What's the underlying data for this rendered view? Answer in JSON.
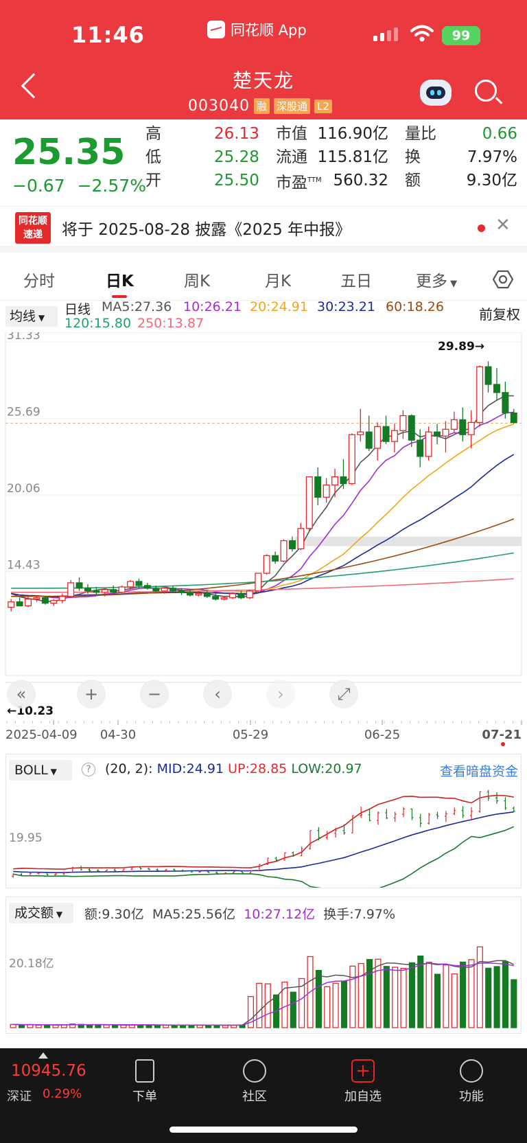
{
  "status": {
    "time": "11:46",
    "app": "同花顺 App",
    "battery": "99"
  },
  "stock": {
    "name": "楚天龙",
    "code": "003040",
    "tags": [
      "融",
      "深股通",
      "L2"
    ],
    "price": "25.35",
    "change": "−0.67",
    "change_pct": "−2.57%"
  },
  "quote": [
    {
      "label": "高",
      "value": "26.13",
      "color": "red"
    },
    {
      "label": "低",
      "value": "25.28",
      "color": "grn"
    },
    {
      "label": "开",
      "value": "25.50",
      "color": "grn"
    }
  ],
  "quote2": [
    {
      "label": "市值",
      "value": "116.90亿"
    },
    {
      "label": "流通",
      "value": "115.81亿"
    },
    {
      "label": "市盈",
      "sup": "TTM",
      "value": "560.32"
    }
  ],
  "quote3": [
    {
      "label": "量比",
      "value": "0.66",
      "color": "grn"
    },
    {
      "label": "换",
      "value": "7.97%"
    },
    {
      "label": "额",
      "value": "9.30亿"
    }
  ],
  "news": {
    "logo": "同花顺速递",
    "text": "将于 2025-08-28 披露《2025 年中报》"
  },
  "tabs": [
    "分时",
    "日K",
    "周K",
    "月K",
    "五日",
    "更多"
  ],
  "ma": {
    "selector": "均线",
    "type": "日线",
    "ma5": "MA5:27.36",
    "ma10": "10:26.21",
    "ma20": "20:24.91",
    "ma30": "30:23.21",
    "ma60": "60:18.26",
    "ma120": "120:15.80",
    "ma250": "250:13.87",
    "adjust": "前复权"
  },
  "chart_data": {
    "type": "candlestick",
    "y_ticks": [
      "31.33",
      "25.69",
      "20.06",
      "14.43"
    ],
    "x_ticks": [
      "2025-04-09",
      "04-30",
      "05-29",
      "06-25",
      "07-21"
    ],
    "ylim": [
      8.8,
      31.33
    ],
    "high_label": "29.89→",
    "low_label": "←10.23",
    "ref_price": 25.35,
    "candles": [
      [
        11.8,
        12.4,
        11.5,
        12.2
      ],
      [
        12.2,
        12.5,
        11.9,
        11.9
      ],
      [
        11.9,
        12.6,
        11.8,
        12.4
      ],
      [
        12.4,
        12.7,
        12.2,
        12.5
      ],
      [
        12.5,
        12.6,
        12.0,
        12.1
      ],
      [
        12.1,
        12.4,
        11.9,
        12.3
      ],
      [
        12.3,
        12.8,
        12.1,
        12.6
      ],
      [
        12.6,
        13.8,
        12.5,
        13.6
      ],
      [
        13.6,
        14.0,
        13.0,
        13.2
      ],
      [
        13.2,
        13.5,
        12.8,
        13.0
      ],
      [
        13.0,
        13.3,
        12.7,
        12.9
      ],
      [
        12.9,
        13.2,
        12.6,
        13.1
      ],
      [
        13.1,
        13.4,
        12.8,
        12.9
      ],
      [
        12.9,
        13.4,
        12.8,
        13.3
      ],
      [
        13.3,
        13.8,
        13.1,
        13.7
      ],
      [
        13.7,
        13.9,
        13.2,
        13.4
      ],
      [
        13.4,
        13.6,
        13.1,
        13.2
      ],
      [
        13.2,
        13.4,
        12.9,
        13.0
      ],
      [
        13.0,
        13.3,
        12.8,
        13.2
      ],
      [
        13.2,
        13.4,
        12.9,
        13.0
      ],
      [
        13.0,
        13.2,
        12.7,
        12.9
      ],
      [
        12.9,
        13.1,
        12.6,
        12.7
      ],
      [
        12.7,
        13.0,
        12.6,
        12.8
      ],
      [
        12.8,
        13.0,
        12.5,
        12.6
      ],
      [
        12.6,
        12.8,
        12.3,
        12.4
      ],
      [
        12.4,
        12.6,
        12.3,
        12.5
      ],
      [
        12.5,
        12.9,
        12.4,
        12.8
      ],
      [
        12.8,
        13.0,
        12.4,
        12.5
      ],
      [
        12.5,
        13.1,
        12.4,
        13.0
      ],
      [
        13.0,
        14.3,
        12.9,
        14.3
      ],
      [
        14.3,
        15.7,
        14.2,
        15.6
      ],
      [
        15.6,
        15.9,
        15.0,
        15.2
      ],
      [
        15.2,
        16.8,
        15.1,
        16.7
      ],
      [
        16.7,
        17.0,
        15.9,
        16.1
      ],
      [
        16.1,
        18.0,
        16.0,
        17.6
      ],
      [
        17.6,
        21.4,
        17.4,
        21.4
      ],
      [
        21.4,
        22.1,
        19.3,
        19.9
      ],
      [
        19.9,
        21.3,
        19.5,
        20.8
      ],
      [
        20.8,
        22.0,
        19.9,
        21.4
      ],
      [
        21.4,
        22.7,
        20.5,
        20.9
      ],
      [
        20.9,
        24.6,
        20.8,
        24.5
      ],
      [
        24.5,
        26.4,
        24.0,
        24.7
      ],
      [
        24.7,
        25.9,
        23.3,
        23.5
      ],
      [
        23.5,
        25.4,
        22.6,
        25.1
      ],
      [
        25.1,
        25.9,
        23.8,
        24.0
      ],
      [
        24.0,
        25.3,
        23.2,
        24.8
      ],
      [
        24.8,
        26.3,
        24.2,
        25.9
      ],
      [
        25.9,
        26.0,
        23.6,
        24.1
      ],
      [
        24.1,
        24.9,
        22.1,
        22.9
      ],
      [
        22.9,
        25.1,
        22.6,
        24.7
      ],
      [
        24.7,
        25.3,
        23.8,
        24.4
      ],
      [
        24.4,
        25.5,
        23.2,
        24.9
      ],
      [
        24.9,
        26.2,
        24.6,
        25.6
      ],
      [
        25.6,
        26.5,
        24.0,
        24.5
      ],
      [
        24.5,
        26.3,
        23.5,
        25.4
      ],
      [
        25.4,
        29.6,
        25.1,
        29.5
      ],
      [
        29.5,
        29.9,
        27.6,
        28.2
      ],
      [
        28.2,
        29.4,
        27.0,
        27.6
      ],
      [
        27.6,
        28.4,
        25.7,
        26.1
      ],
      [
        26.1,
        26.4,
        25.3,
        25.4
      ]
    ]
  },
  "boll": {
    "selector": "BOLL",
    "params": "(20, 2):",
    "mid": "MID:24.91",
    "up": "UP:28.85",
    "low": "LOW:20.97",
    "link": "查看暗盘资金",
    "tick": "19.95"
  },
  "volume": {
    "selector": "成交额",
    "amount": "额:9.30亿",
    "ma5": "MA5:25.56亿",
    "ma10": "10:27.12亿",
    "turnover": "换手:7.97%",
    "tick": "20.18亿"
  },
  "bottom": {
    "index_value": "10945.76",
    "index_name": "深证",
    "index_pct": "0.29%",
    "items": [
      "下单",
      "社区",
      "加自选",
      "功能"
    ]
  }
}
